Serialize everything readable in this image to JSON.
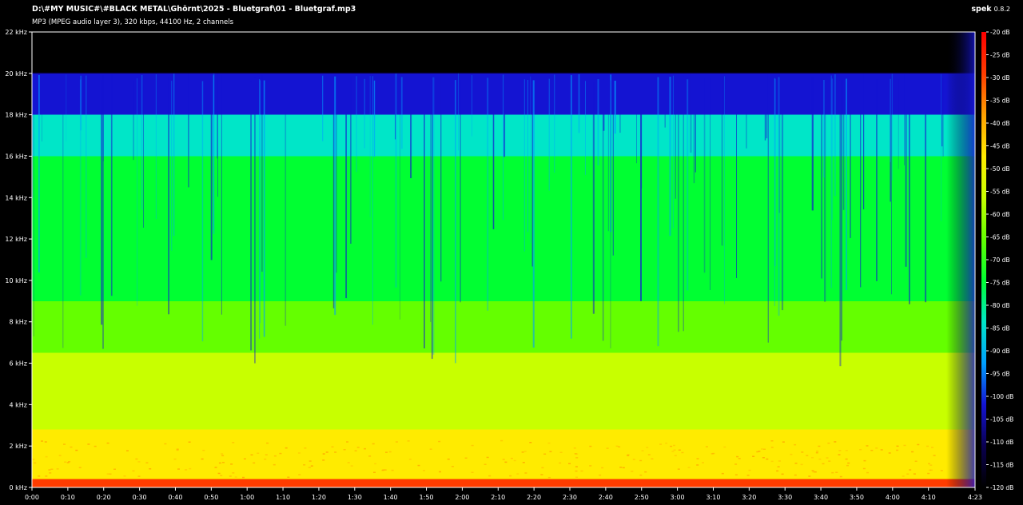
{
  "file": {
    "path": "D:\\#MY MUSIC#\\#BLACK METAL\\Ghörnt\\2025 - Bluetgraf\\01 - Bluetgraf.mp3",
    "info": "MP3 (MPEG audio layer 3), 320 kbps, 44100 Hz, 2 channels"
  },
  "app": {
    "name": "spek",
    "version": "0.8.2"
  },
  "colors": {
    "background": "#000000",
    "frame": "#ffffff",
    "palette": [
      "#000000",
      "#0a0050",
      "#1414d2",
      "#00a0ff",
      "#00e6c8",
      "#00ff32",
      "#64ff00",
      "#c8ff00",
      "#ffeb00",
      "#ffa000",
      "#ff3c00",
      "#ff0000"
    ]
  },
  "chart_data": {
    "type": "heatmap",
    "title": "",
    "xlabel": "",
    "ylabel": "",
    "x": {
      "unit": "time",
      "range_seconds": [
        0,
        263
      ],
      "tick_labels": [
        "0:00",
        "0:10",
        "0:20",
        "0:30",
        "0:40",
        "0:50",
        "1:00",
        "1:10",
        "1:20",
        "1:30",
        "1:40",
        "1:50",
        "2:00",
        "2:10",
        "2:20",
        "2:30",
        "2:40",
        "2:50",
        "3:00",
        "3:10",
        "3:20",
        "3:30",
        "3:40",
        "3:50",
        "4:00",
        "4:10",
        "4:23"
      ],
      "tick_values_seconds": [
        0,
        10,
        20,
        30,
        40,
        50,
        60,
        70,
        80,
        90,
        100,
        110,
        120,
        130,
        140,
        150,
        160,
        170,
        180,
        190,
        200,
        210,
        220,
        230,
        240,
        250,
        263
      ]
    },
    "y": {
      "unit": "kHz",
      "range_khz": [
        0,
        22
      ],
      "tick_labels": [
        "0 kHz",
        "2 kHz",
        "4 kHz",
        "6 kHz",
        "8 kHz",
        "10 kHz",
        "12 kHz",
        "14 kHz",
        "16 kHz",
        "18 kHz",
        "20 kHz",
        "22 kHz"
      ],
      "tick_values_khz": [
        0,
        2,
        4,
        6,
        8,
        10,
        12,
        14,
        16,
        18,
        20,
        22
      ]
    },
    "colorbar": {
      "unit": "dB",
      "range_db": [
        -120,
        -20
      ],
      "tick_labels": [
        "-20 dB",
        "-25 dB",
        "-30 dB",
        "-35 dB",
        "-40 dB",
        "-45 dB",
        "-50 dB",
        "-55 dB",
        "-60 dB",
        "-65 dB",
        "-70 dB",
        "-75 dB",
        "-80 dB",
        "-85 dB",
        "-90 dB",
        "-95 dB",
        "-100 dB",
        "-105 dB",
        "-110 dB",
        "-115 dB",
        "-120 dB"
      ],
      "tick_values_db": [
        -20,
        -25,
        -30,
        -35,
        -40,
        -45,
        -50,
        -55,
        -60,
        -65,
        -70,
        -75,
        -80,
        -85,
        -90,
        -95,
        -100,
        -105,
        -110,
        -115,
        -120
      ]
    },
    "spectrum": {
      "lowpass_cutoff_khz": 20,
      "energy_bands": [
        {
          "freq_khz": [
            0,
            0.4
          ],
          "level_db": -30
        },
        {
          "freq_khz": [
            0.4,
            2.8
          ],
          "level_db": -45
        },
        {
          "freq_khz": [
            2.8,
            6.5
          ],
          "level_db": -52
        },
        {
          "freq_khz": [
            6.5,
            9
          ],
          "level_db": -62
        },
        {
          "freq_khz": [
            9,
            16
          ],
          "level_db": -72
        },
        {
          "freq_khz": [
            16,
            18
          ],
          "level_db": -82
        },
        {
          "freq_khz": [
            18,
            20
          ],
          "level_db": -100
        }
      ],
      "fade_out_start_seconds": 255
    },
    "grid": false,
    "legend": "right"
  }
}
